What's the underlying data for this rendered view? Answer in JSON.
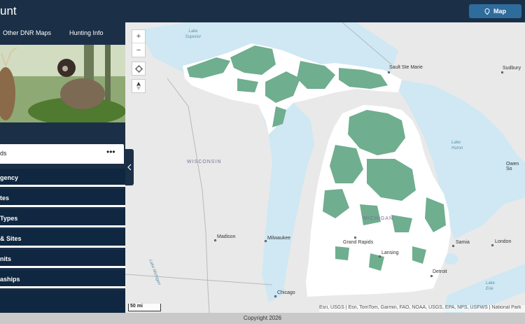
{
  "header": {
    "title": "unt",
    "map_button_label": "Map"
  },
  "nav": {
    "items": [
      "Other DNR Maps",
      "Hunting Info"
    ]
  },
  "sidebar": {
    "search_text": "ds",
    "more_label": "•••",
    "sections": [
      "gency",
      "tes",
      "Types",
      "& Sites",
      "nits",
      "aships"
    ],
    "collapse_icon": "chevron-left-icon"
  },
  "map": {
    "labels": {
      "water": [
        "Lake Superior",
        "Lake Huron",
        "Lake Michigan",
        "Lake Erie"
      ],
      "states": [
        "WISCONSIN",
        "MICHIGAN"
      ],
      "cities": [
        "Sault Ste Marie",
        "Sudbury",
        "Owen So",
        "Madison",
        "Milwaukee",
        "Grand Rapids",
        "Lansing",
        "Samia",
        "London",
        "Detroit",
        "Chicago"
      ]
    },
    "scale": "50 mi",
    "attribution": "Esri, USGS | Esri, TomTom, Garmin, FAO, NOAA, USGS, EPA, NPS, USFWS | National Park",
    "colors": {
      "land": "#ffffff",
      "water": "#cfe8f3",
      "public_land": "#6fae8f"
    }
  },
  "footer": {
    "copyright": "Copyright 2026"
  }
}
